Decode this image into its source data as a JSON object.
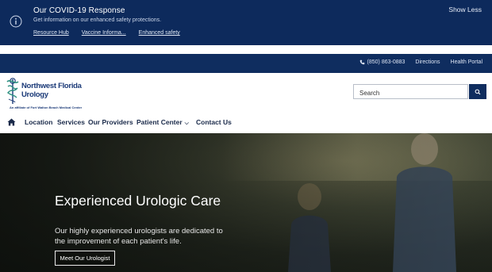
{
  "covid": {
    "title": "Our COVID-19 Response",
    "subtitle": "Get information on our enhanced safety protections.",
    "links": [
      "Resource Hub",
      "Vaccine Informa...",
      "Enhanced safety"
    ],
    "show_less": "Show Less"
  },
  "utility": {
    "phone": "(850) 863-0883",
    "directions": "Directions",
    "health_portal": "Health Portal"
  },
  "logo": {
    "line1": "Northwest Florida",
    "line2": "Urology",
    "tagline": "An affiliate of Fort Walton Beach Medical Center"
  },
  "search": {
    "placeholder": "Search"
  },
  "nav": {
    "items": [
      "Location",
      "Services",
      "Our Providers",
      "Patient Center",
      "Contact Us"
    ]
  },
  "hero": {
    "title": "Experienced Urologic Care",
    "body": "Our highly experienced urologists are dedicated to the improvement of each patient's life.",
    "button": "Meet Our Urologist"
  },
  "colors": {
    "navy": "#0d2a5c",
    "nav_text": "#1a2a4a",
    "logo_blue": "#1b3a78"
  },
  "icons": {
    "info": "info-icon",
    "phone": "phone-icon",
    "search": "search-icon",
    "home": "home-icon",
    "dropdown": "chevron-down-icon"
  }
}
